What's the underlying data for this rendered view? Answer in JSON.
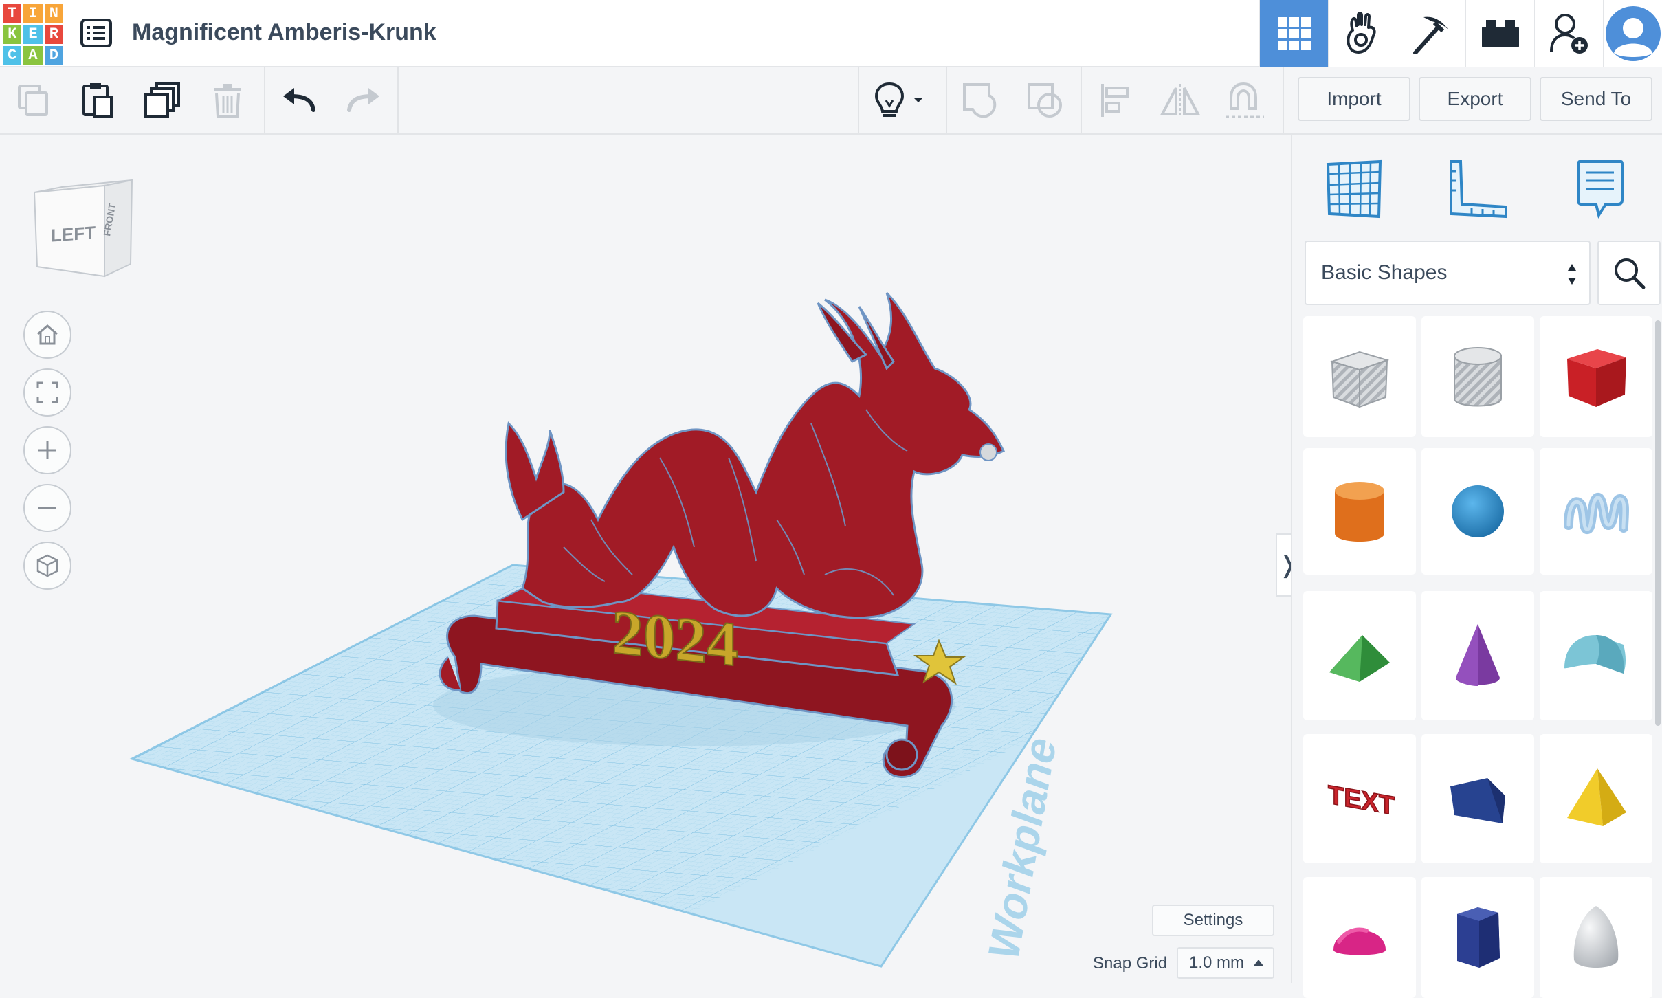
{
  "app": {
    "logo_letters": [
      "T",
      "I",
      "N",
      "K",
      "E",
      "R",
      "C",
      "A",
      "D"
    ],
    "logo_colors": [
      "#e8483d",
      "#f8a539",
      "#f8a539",
      "#8ac43f",
      "#4fc1e8",
      "#e8483d",
      "#4fc1e8",
      "#8ac43f",
      "#4fa4e0"
    ],
    "design_title": "Magnificent Amberis-Krunk"
  },
  "top_icons": [
    {
      "name": "3d-design-grid-icon",
      "active": true
    },
    {
      "name": "circuits-hand-icon",
      "active": false
    },
    {
      "name": "pickaxe-icon",
      "active": false
    },
    {
      "name": "bricks-icon",
      "active": false
    },
    {
      "name": "add-user-icon",
      "active": false
    },
    {
      "name": "user-avatar-icon",
      "active": false
    }
  ],
  "toolbar": {
    "import_label": "Import",
    "export_label": "Export",
    "send_to_label": "Send To"
  },
  "viewcube": {
    "left_label": "LEFT",
    "front_label": "FRONT"
  },
  "scene": {
    "year_text": "2024",
    "workplane_label": "Workplane"
  },
  "canvas": {
    "settings_label": "Settings",
    "snap_grid_label": "Snap Grid",
    "snap_grid_value": "1.0 mm"
  },
  "panel": {
    "category_label": "Basic Shapes",
    "shapes": [
      {
        "name": "box-hole",
        "color": "#b9bec4"
      },
      {
        "name": "cylinder-hole",
        "color": "#b9bec4"
      },
      {
        "name": "box",
        "color": "#d3272b"
      },
      {
        "name": "cylinder",
        "color": "#e57a25"
      },
      {
        "name": "sphere",
        "color": "#2f8fd0"
      },
      {
        "name": "scribble",
        "color": "#9ec5e6"
      },
      {
        "name": "roof",
        "color": "#3fa64a"
      },
      {
        "name": "cone",
        "color": "#7a3aa0"
      },
      {
        "name": "round-roof",
        "color": "#7cc5d6"
      },
      {
        "name": "text",
        "color": "#c9242b"
      },
      {
        "name": "wedge",
        "color": "#274390"
      },
      {
        "name": "pyramid",
        "color": "#f1cc2a"
      },
      {
        "name": "half-sphere",
        "color": "#d82586"
      },
      {
        "name": "polygon",
        "color": "#2c3f92"
      },
      {
        "name": "paraboloid",
        "color": "#d4d7da"
      }
    ],
    "text_shape_label": "TEXT"
  }
}
